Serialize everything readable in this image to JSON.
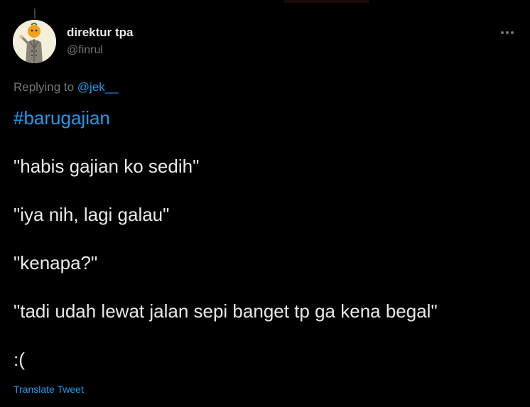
{
  "author": {
    "display_name": "direktur tpa",
    "handle": "@finrul"
  },
  "reply": {
    "prefix": "Replying to ",
    "mention": "@jek__"
  },
  "tweet": {
    "hashtag": "#barugajian",
    "lines": [
      "\"habis gajian ko sedih\"",
      "\"iya nih, lagi galau\"",
      "\"kenapa?\"",
      "\"tadi udah lewat jalan sepi banget tp ga kena begal\"",
      ":("
    ]
  },
  "translate_label": "Translate Tweet",
  "icons": {
    "more": "more-horizontal-icon",
    "avatar": "avatar-illustration"
  },
  "colors": {
    "background": "#000000",
    "text": "#e7e9ea",
    "secondary": "#71767b",
    "accent": "#1d9bf0"
  }
}
